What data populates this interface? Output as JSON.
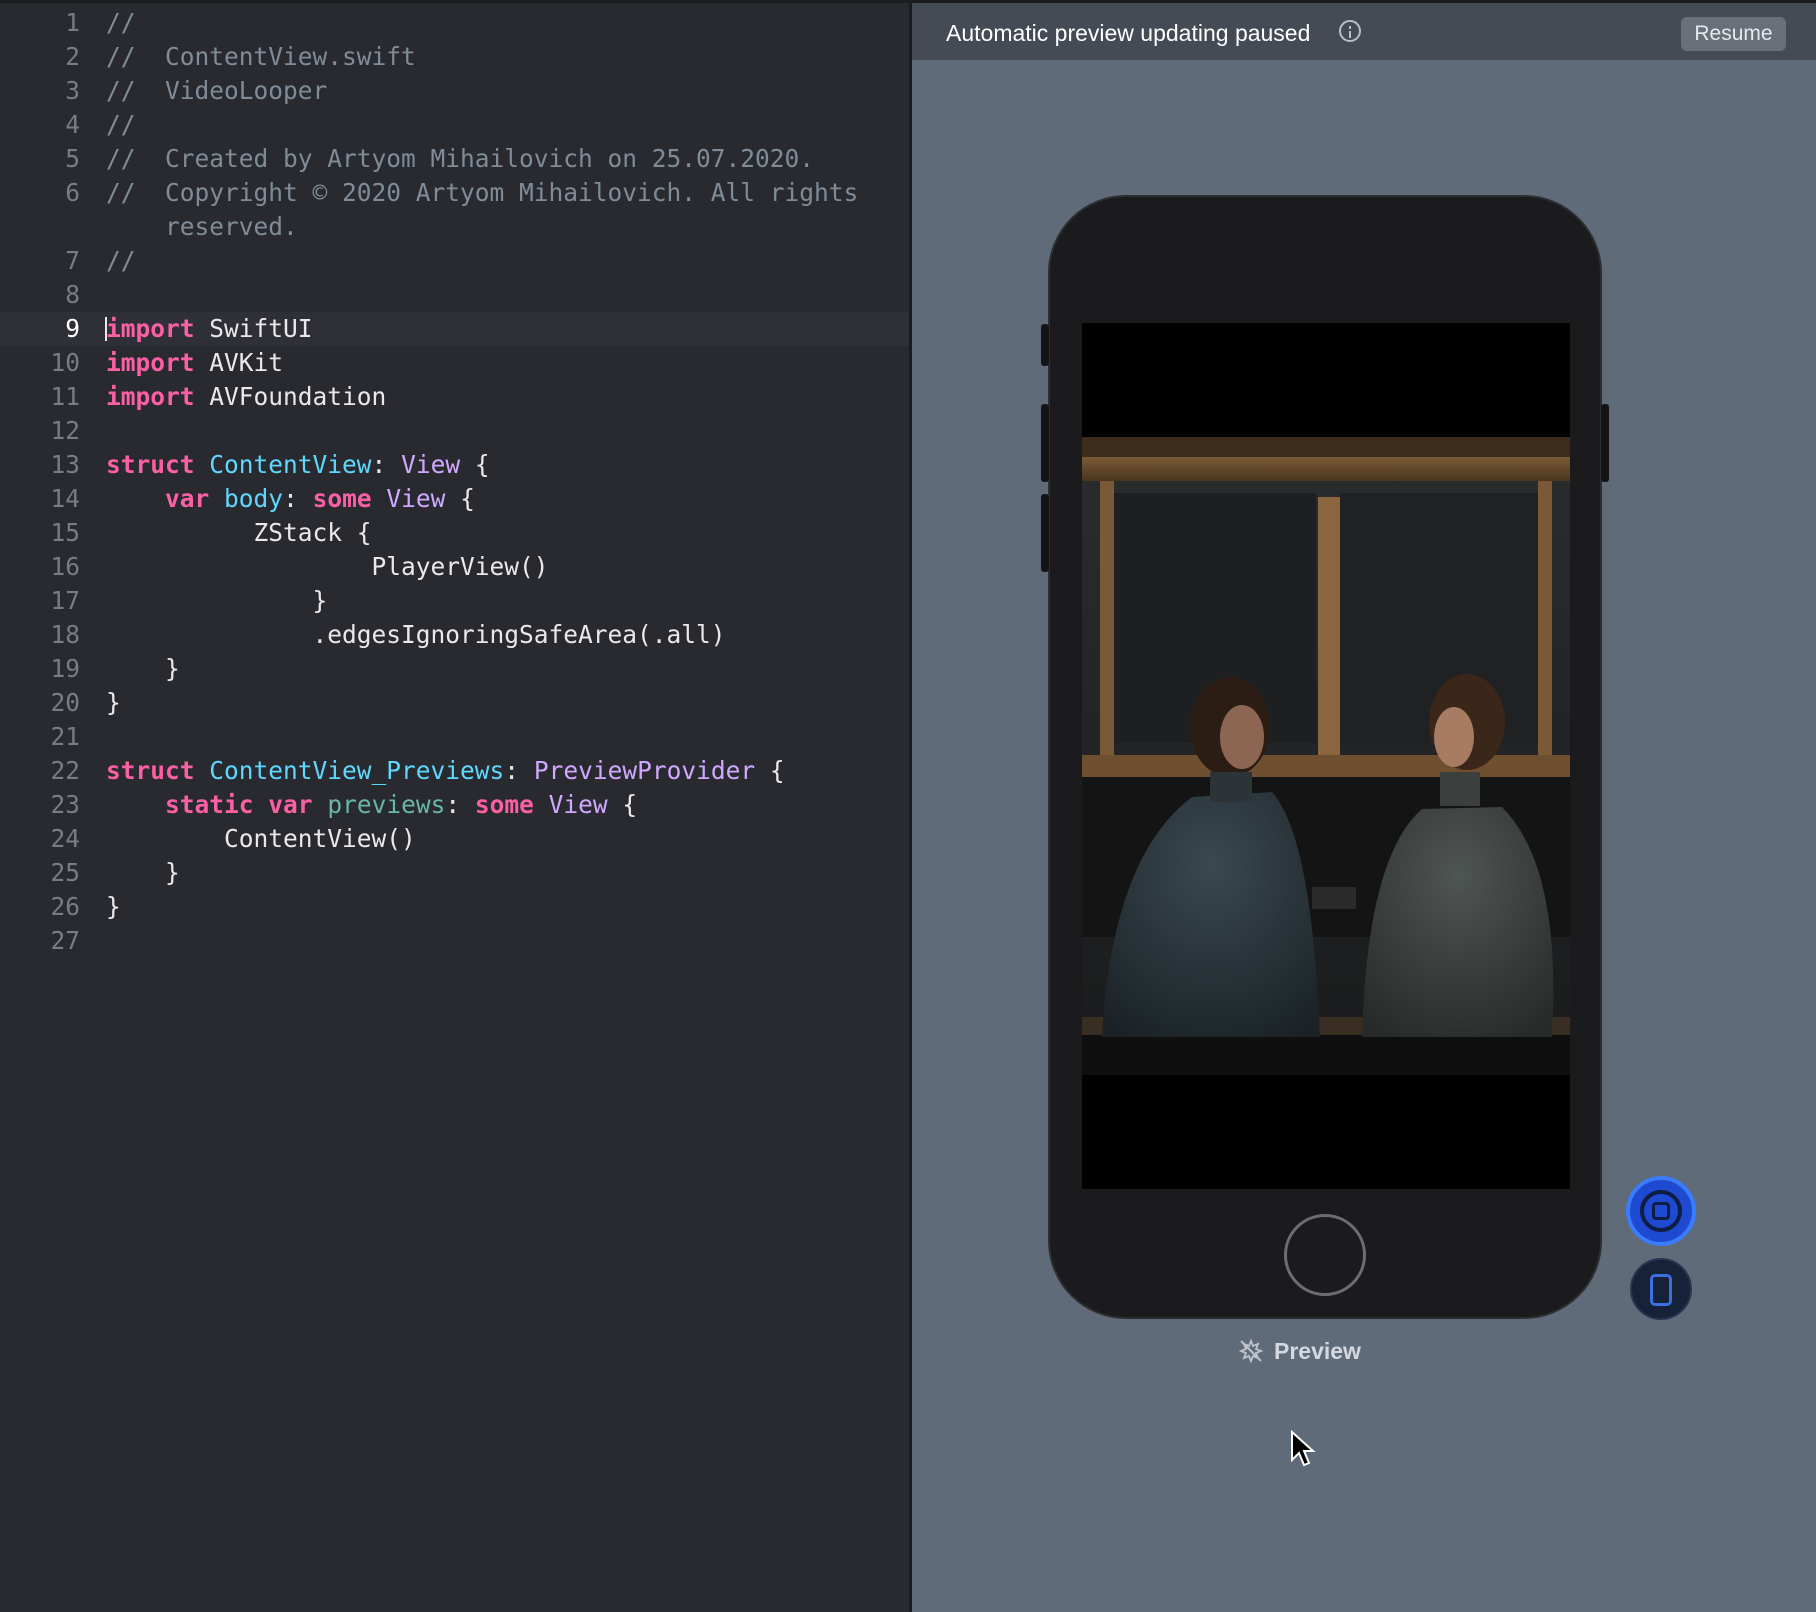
{
  "editor": {
    "current_line": 9,
    "lines": [
      {
        "n": "1",
        "tokens": [
          {
            "t": "//",
            "c": "cm"
          }
        ]
      },
      {
        "n": "2",
        "tokens": [
          {
            "t": "//  ContentView.swift",
            "c": "cm"
          }
        ]
      },
      {
        "n": "3",
        "tokens": [
          {
            "t": "//  VideoLooper",
            "c": "cm"
          }
        ]
      },
      {
        "n": "4",
        "tokens": [
          {
            "t": "//",
            "c": "cm"
          }
        ]
      },
      {
        "n": "5",
        "tokens": [
          {
            "t": "//  Created by Artyom Mihailovich on 25.07.2020.",
            "c": "cm"
          }
        ]
      },
      {
        "n": "6",
        "wrap": true,
        "tokens": [
          {
            "t": "//  Copyright © 2020 Artyom Mihailovich. All rights\n    reserved.",
            "c": "cm"
          }
        ]
      },
      {
        "n": "7",
        "tokens": [
          {
            "t": "//",
            "c": "cm"
          }
        ]
      },
      {
        "n": "8",
        "tokens": []
      },
      {
        "n": "9",
        "tokens": [
          {
            "t": "import",
            "c": "kw"
          },
          {
            "t": " SwiftUI",
            "c": "pl"
          }
        ]
      },
      {
        "n": "10",
        "tokens": [
          {
            "t": "import",
            "c": "kw"
          },
          {
            "t": " AVKit",
            "c": "pl"
          }
        ]
      },
      {
        "n": "11",
        "tokens": [
          {
            "t": "import",
            "c": "kw"
          },
          {
            "t": " AVFoundation",
            "c": "pl"
          }
        ]
      },
      {
        "n": "12",
        "tokens": []
      },
      {
        "n": "13",
        "tokens": [
          {
            "t": "struct",
            "c": "kw"
          },
          {
            "t": " ",
            "c": "pl"
          },
          {
            "t": "ContentView",
            "c": "ty"
          },
          {
            "t": ": ",
            "c": "pl"
          },
          {
            "t": "View",
            "c": "sys"
          },
          {
            "t": " {",
            "c": "pl"
          }
        ]
      },
      {
        "n": "14",
        "tokens": [
          {
            "t": "    ",
            "c": "pl"
          },
          {
            "t": "var",
            "c": "kw"
          },
          {
            "t": " ",
            "c": "pl"
          },
          {
            "t": "body",
            "c": "ty"
          },
          {
            "t": ": ",
            "c": "pl"
          },
          {
            "t": "some",
            "c": "kw"
          },
          {
            "t": " ",
            "c": "pl"
          },
          {
            "t": "View",
            "c": "sys"
          },
          {
            "t": " {",
            "c": "pl"
          }
        ]
      },
      {
        "n": "15",
        "tokens": [
          {
            "t": "          ZStack {",
            "c": "pl"
          }
        ]
      },
      {
        "n": "16",
        "tokens": [
          {
            "t": "                  PlayerView()",
            "c": "pl"
          }
        ]
      },
      {
        "n": "17",
        "tokens": [
          {
            "t": "              }",
            "c": "pl"
          }
        ]
      },
      {
        "n": "18",
        "tokens": [
          {
            "t": "              .edgesIgnoringSafeArea(.all)",
            "c": "pl"
          }
        ]
      },
      {
        "n": "19",
        "tokens": [
          {
            "t": "    }",
            "c": "pl"
          }
        ]
      },
      {
        "n": "20",
        "tokens": [
          {
            "t": "}",
            "c": "pl"
          }
        ]
      },
      {
        "n": "21",
        "tokens": []
      },
      {
        "n": "22",
        "tokens": [
          {
            "t": "struct",
            "c": "kw"
          },
          {
            "t": " ",
            "c": "pl"
          },
          {
            "t": "ContentView_Previews",
            "c": "ty"
          },
          {
            "t": ": ",
            "c": "pl"
          },
          {
            "t": "PreviewProvider",
            "c": "sys"
          },
          {
            "t": " {",
            "c": "pl"
          }
        ]
      },
      {
        "n": "23",
        "tokens": [
          {
            "t": "    ",
            "c": "pl"
          },
          {
            "t": "static",
            "c": "kw"
          },
          {
            "t": " ",
            "c": "pl"
          },
          {
            "t": "var",
            "c": "kw"
          },
          {
            "t": " ",
            "c": "pl"
          },
          {
            "t": "previews",
            "c": "prop"
          },
          {
            "t": ": ",
            "c": "pl"
          },
          {
            "t": "some",
            "c": "kw"
          },
          {
            "t": " ",
            "c": "pl"
          },
          {
            "t": "View",
            "c": "sys"
          },
          {
            "t": " {",
            "c": "pl"
          }
        ]
      },
      {
        "n": "24",
        "tokens": [
          {
            "t": "        ContentView()",
            "c": "pl"
          }
        ]
      },
      {
        "n": "25",
        "tokens": [
          {
            "t": "    }",
            "c": "pl"
          }
        ]
      },
      {
        "n": "26",
        "tokens": [
          {
            "t": "}",
            "c": "pl"
          }
        ]
      },
      {
        "n": "27",
        "tokens": []
      }
    ]
  },
  "canvas": {
    "banner_text": "Automatic preview updating paused",
    "resume_label": "Resume",
    "preview_label": "Preview",
    "accent_color": "#1e4ad1",
    "info_icon": "info-circle-icon",
    "device_icon": "iphone-icon",
    "live_icon": "live-preview-icon",
    "pin_icon": "preview-pin-icon",
    "cursor_icon": "mouse-pointer-icon"
  }
}
